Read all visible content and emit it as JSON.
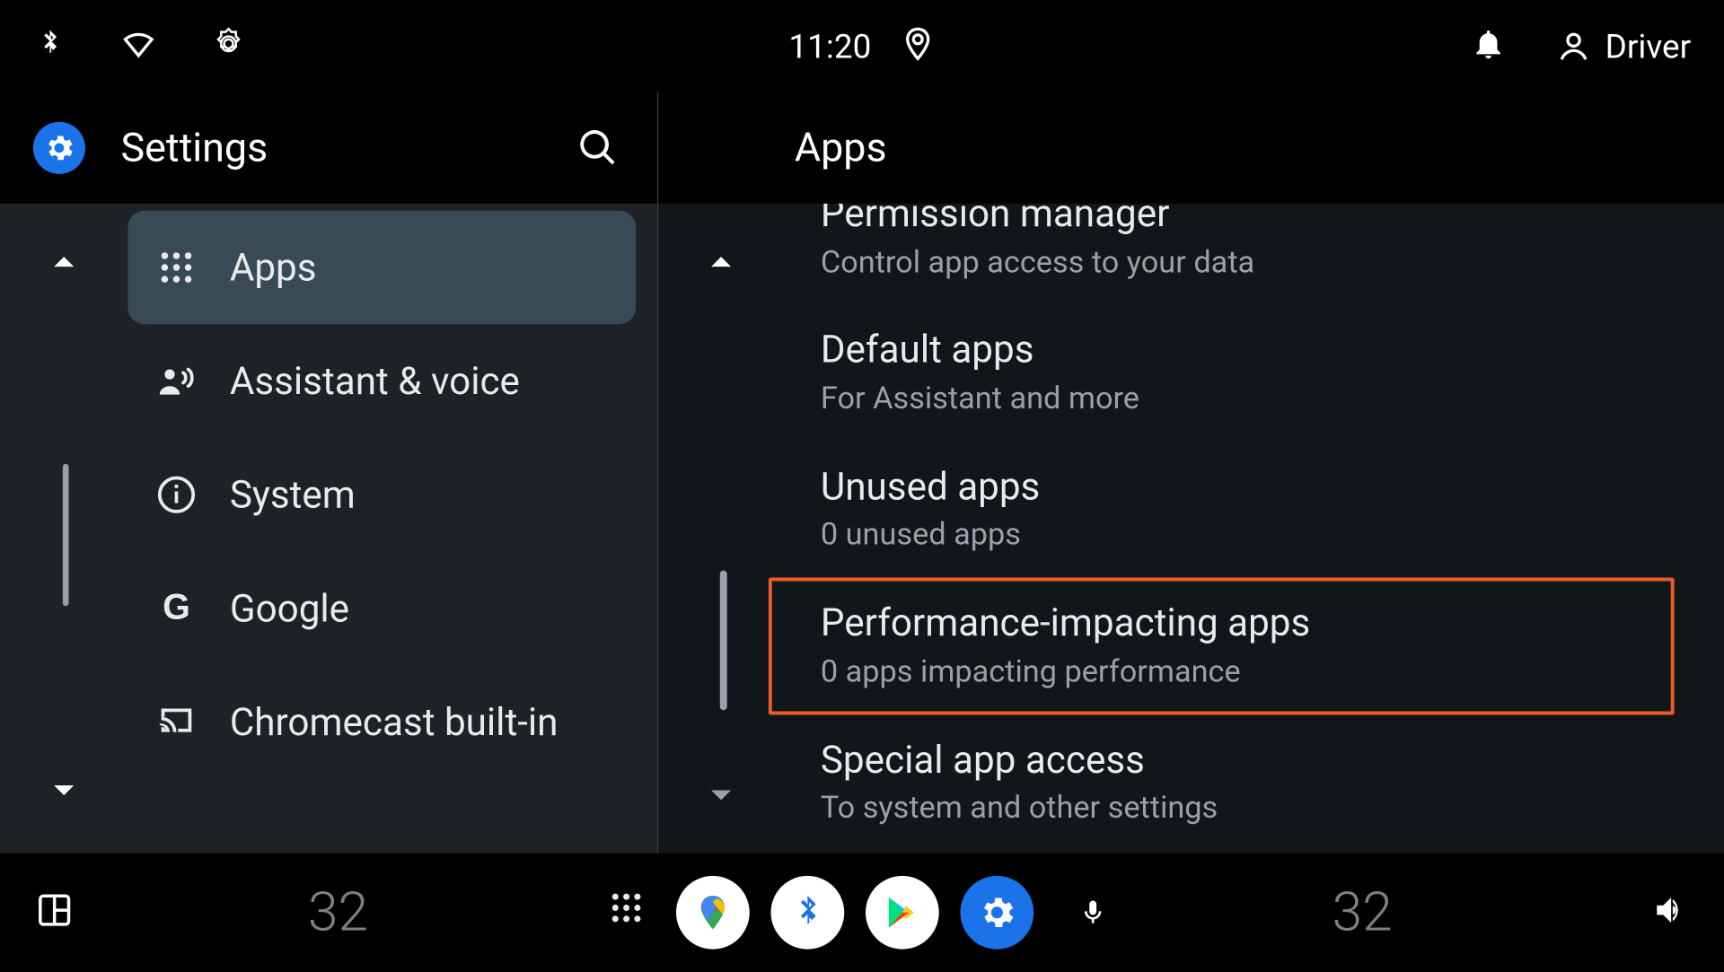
{
  "statusbar": {
    "time": "11:20",
    "user_label": "Driver"
  },
  "left": {
    "title": "Settings",
    "items": [
      {
        "label": "Apps",
        "icon": "apps-grid-icon",
        "selected": true
      },
      {
        "label": "Assistant & voice",
        "icon": "assistant-voice-icon",
        "selected": false
      },
      {
        "label": "System",
        "icon": "info-icon",
        "selected": false
      },
      {
        "label": "Google",
        "icon": "google-g-icon",
        "selected": false
      },
      {
        "label": "Chromecast built-in",
        "icon": "cast-icon",
        "selected": false
      }
    ]
  },
  "right": {
    "title": "Apps",
    "items": [
      {
        "title": "Permission manager",
        "sub": "Control app access to your data",
        "highlight": false
      },
      {
        "title": "Default apps",
        "sub": "For Assistant and more",
        "highlight": false
      },
      {
        "title": "Unused apps",
        "sub": "0 unused apps",
        "highlight": false
      },
      {
        "title": "Performance-impacting apps",
        "sub": "0 apps impacting performance",
        "highlight": true
      },
      {
        "title": "Special app access",
        "sub": "To system and other settings",
        "highlight": false
      }
    ]
  },
  "navbar": {
    "temp_left": "32",
    "temp_right": "32"
  }
}
